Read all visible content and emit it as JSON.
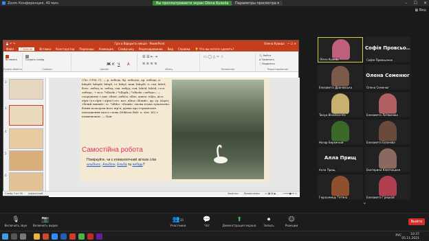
{
  "zoom": {
    "title": "Zoom Конференция, 40 мин",
    "share_banner": "Вы просматриваете экран Olena Kuxeda",
    "view_options": "Параметры просмотра",
    "speaker_view": "Вид"
  },
  "ppt": {
    "title": "Гріх в Відкрита лекція - PowerPoint",
    "user": "Олена Куведа",
    "tabs": [
      "Файл",
      "Главная",
      "Вставка",
      "Конструктор",
      "Переходы",
      "Анимация",
      "Слайд-шоу",
      "Рецензирование",
      "Вид",
      "Справка",
      "Что вы хотите сделать?"
    ],
    "active_tab": "Главная",
    "ribbon": {
      "paste": "Вставить",
      "create_slide": "Создать слайд",
      "font_box": "Шрифт цвета",
      "font_tooltip": "Предыдущий слайд шрифт",
      "groups": [
        "Буфер обмена",
        "Слайды",
        "Шрифт",
        "Абзац",
        "Рисование",
        "Редактирование"
      ],
      "find": "Найти",
      "replace": "Заменить",
      "select": "Выделить"
    },
    "notes": "Щелкните, чтобы добавить заметки",
    "status": [
      "Слайд 3 из 36",
      "украинский",
      "Заметки",
      "Примечания"
    ],
    "slide_numbers": [
      "2",
      "3",
      "4",
      "5",
      "6",
      "7"
    ]
  },
  "slide": {
    "text": "(Літ. СУМ, Г); — р. лебедь, бр. лебедзь, др. лебедь, п. łabędź, łabędź, łabętl, ст. łabęć, каш. łabądź, ч. слц. labuť, болг. лебед, м. лебед, схв. лабуд, слн. labód, labód, стсл. лебедь; ·• псл. *elbedь / *elbędь / *olbedь «лебідь»; — споріднене з дан. elbist, албіća, elbis, данга. ieljiu, дісл. elptr (ел elptr і alptir) етс. нат. albus «білий», др. гр. ἀλφός «білий лишай»; іе. *albho- «білий»; назва птаха зумовлена білим кольором його пір'я; думка про германське походження цього слова (Міklosa Balt. u. slav. 40) є помилковою. — Кан-",
    "heading": "Самостійна робота",
    "task_pre": "Поміркуйте, чи є етимологічний зв'язок слів ",
    "link1": "альбінос",
    "link2": "Альбіон",
    "link3": "Ельба",
    "task_and": " та ",
    "link4": "лебідь",
    "task_post": "?"
  },
  "participants": [
    {
      "name": "Olena Kuxeda",
      "type": "video",
      "color": "#c0607a"
    },
    {
      "name": "Софія Провсьонок",
      "type": "name",
      "display": "Софія Провсьо...",
      "color": "#222"
    },
    {
      "name": "Елизавета Драновська",
      "type": "video",
      "color": "#7a5a4a"
    },
    {
      "name": "Олена Семенюг",
      "type": "name",
      "display": "Олена Семенюг",
      "color": "#222"
    },
    {
      "name": "Tasiya Biloshkvirets",
      "type": "video",
      "color": "#c8b070"
    },
    {
      "name": "Елизавета Литвинова",
      "type": "video",
      "color": "#b06060"
    },
    {
      "name": "Назар Бережний",
      "type": "video",
      "color": "#3a6a2a"
    },
    {
      "name": "Елизавета Біланова",
      "type": "video",
      "color": "#6a4a3a"
    },
    {
      "name": "Алла Прищ",
      "type": "name",
      "display": "Алла Прищ",
      "color": "#222"
    },
    {
      "name": "Екатерина Клепчицкая",
      "type": "video",
      "color": "#8a6a60"
    },
    {
      "name": "Герасимець Тетяна",
      "type": "video",
      "color": "#905030"
    },
    {
      "name": "Елизавета Грицкай",
      "type": "video",
      "color": "#b04050"
    }
  ],
  "controls": {
    "mic": "Включить звук",
    "video": "Включить видео",
    "participants": "Участники",
    "participants_count": "21",
    "chat": "Чат",
    "share": "Демонстрация экрана",
    "record": "Запись",
    "reactions": "Реакции",
    "leave": "Выйти"
  },
  "taskbar": {
    "time": "10:37",
    "date": "05.11.2021",
    "lang": "РУС"
  }
}
